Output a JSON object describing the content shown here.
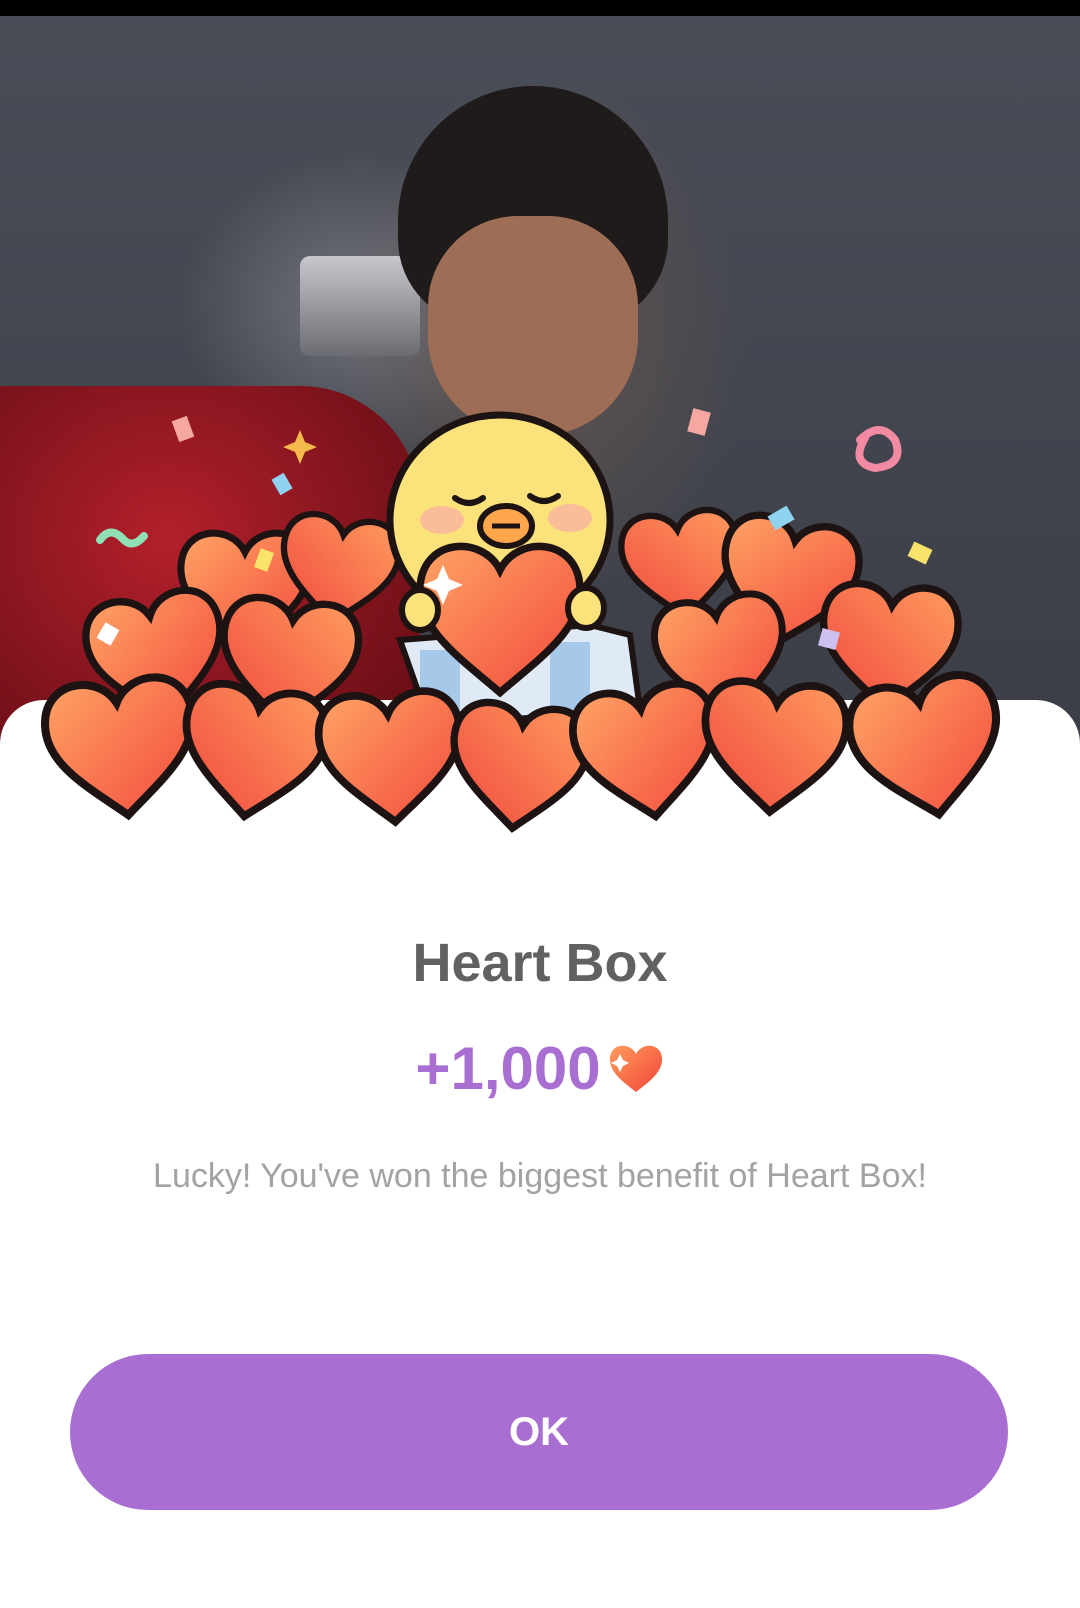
{
  "dialog": {
    "title": "Heart Box",
    "reward_amount": "+1,000",
    "message": "Lucky! You've won the biggest benefit of Heart Box!",
    "ok_label": "OK"
  },
  "icons": {
    "reward": "heart-icon",
    "hero": "chick-holding-heart-illustration"
  },
  "colors": {
    "accent": "#a86ed1",
    "title": "#616161",
    "message": "#a3a3a3",
    "heart_light": "#ffa365",
    "heart_dark": "#f24a3c"
  }
}
